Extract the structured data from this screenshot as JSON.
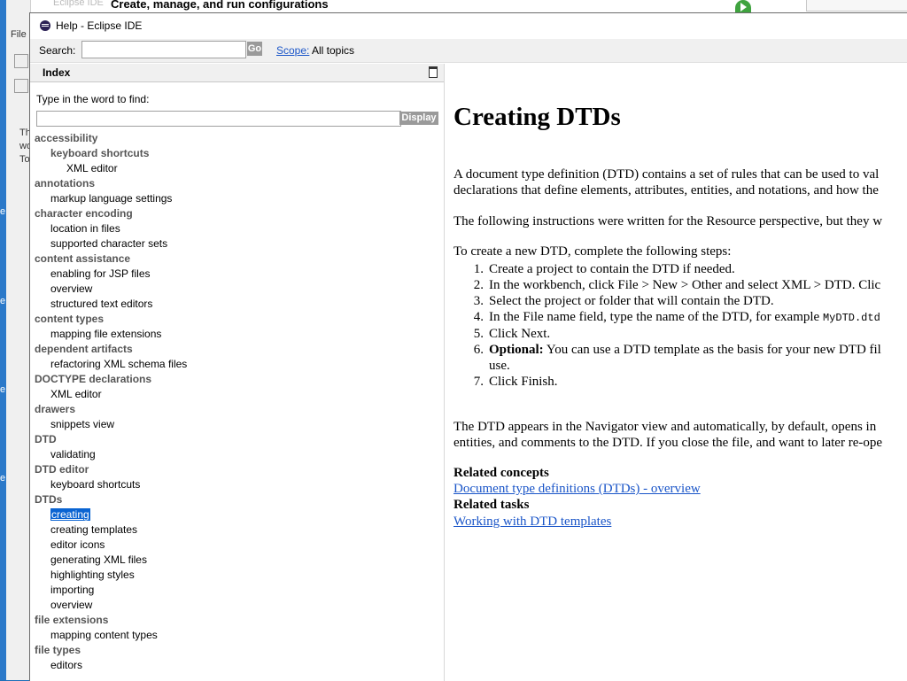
{
  "background_window": {
    "title": "Create, manage, and run configurations",
    "app_title": "Eclipse IDE",
    "left_items": [
      "File",
      "Th",
      "wo",
      "To",
      "e",
      "e",
      "e",
      "e"
    ]
  },
  "help_window": {
    "title": "Help - Eclipse IDE",
    "search": {
      "label": "Search:",
      "value": "",
      "go_label": "Go",
      "scope_label": "Scope:",
      "scope_value": "All topics"
    },
    "index": {
      "title": "Index",
      "type_label": "Type in the word to find:",
      "find_value": "",
      "display_label": "Display",
      "entries": [
        {
          "label": "accessibility",
          "level": 0
        },
        {
          "label": "keyboard shortcuts",
          "level": 1,
          "bold": true
        },
        {
          "label": "XML editor",
          "level": 2
        },
        {
          "label": "annotations",
          "level": 0
        },
        {
          "label": "markup language settings",
          "level": 1
        },
        {
          "label": "character encoding",
          "level": 0
        },
        {
          "label": "location in files",
          "level": 1
        },
        {
          "label": "supported character sets",
          "level": 1
        },
        {
          "label": "content assistance",
          "level": 0
        },
        {
          "label": "enabling for JSP files",
          "level": 1
        },
        {
          "label": "overview",
          "level": 1
        },
        {
          "label": "structured text editors",
          "level": 1
        },
        {
          "label": "content types",
          "level": 0
        },
        {
          "label": "mapping file extensions",
          "level": 1
        },
        {
          "label": "dependent artifacts",
          "level": 0
        },
        {
          "label": "refactoring XML schema files",
          "level": 1
        },
        {
          "label": "DOCTYPE declarations",
          "level": 0
        },
        {
          "label": "XML editor",
          "level": 1
        },
        {
          "label": "drawers",
          "level": 0
        },
        {
          "label": "snippets view",
          "level": 1
        },
        {
          "label": "DTD",
          "level": 0
        },
        {
          "label": "validating",
          "level": 1
        },
        {
          "label": "DTD editor",
          "level": 0
        },
        {
          "label": "keyboard shortcuts",
          "level": 1
        },
        {
          "label": "DTDs",
          "level": 0
        },
        {
          "label": "creating",
          "level": 1,
          "selected": true
        },
        {
          "label": "creating templates",
          "level": 1
        },
        {
          "label": "editor icons",
          "level": 1
        },
        {
          "label": "generating XML files",
          "level": 1
        },
        {
          "label": "highlighting styles",
          "level": 1
        },
        {
          "label": "importing",
          "level": 1
        },
        {
          "label": "overview",
          "level": 1
        },
        {
          "label": "file extensions",
          "level": 0
        },
        {
          "label": "mapping content types",
          "level": 1
        },
        {
          "label": "file types",
          "level": 0
        },
        {
          "label": "editors",
          "level": 1
        }
      ]
    },
    "content": {
      "heading": "Creating DTDs",
      "intro_line1": "A document type definition (DTD) contains a set of rules that can be used to val",
      "intro_line2": "declarations that define elements, attributes, entities, and notations, and how the",
      "perspective_note": "The following instructions were written for the Resource perspective, but they w",
      "steps_intro": "To create a new DTD, complete the following steps:",
      "steps": [
        {
          "num": "1.",
          "text": "Create a project to contain the DTD if needed."
        },
        {
          "num": "2.",
          "text": "In the workbench, click File > New > Other and select XML > DTD. Clic"
        },
        {
          "num": "3.",
          "text": "Select the project or folder that will contain the DTD."
        },
        {
          "num": "4.",
          "text": "In the File name field, type the name of the DTD, for example ",
          "code": "MyDTD.dtd"
        },
        {
          "num": "5.",
          "text": "Click Next."
        },
        {
          "num": "6.",
          "bold": "Optional:",
          "text": " You can use a DTD template as the basis for your new DTD fil",
          "cont": "use."
        },
        {
          "num": "7.",
          "text": "Click Finish."
        }
      ],
      "outro_line1": "The DTD appears in the Navigator view and automatically, by default, opens in",
      "outro_line2": "entities, and comments to the DTD. If you close the file, and want to later re-ope",
      "related_concepts_title": "Related concepts",
      "related_concepts_link": "Document type definitions (DTDs) - overview",
      "related_tasks_title": "Related tasks",
      "related_tasks_link": "Working with DTD templates"
    }
  }
}
